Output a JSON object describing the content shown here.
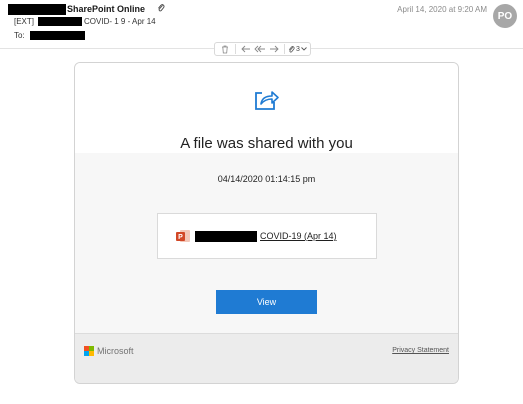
{
  "header": {
    "sender_name": "SharePoint Online",
    "subject_prefix": "[EXT]",
    "subject_suffix": "COVID- 1 9 - Apr 14",
    "to_label": "To:",
    "date": "April 14, 2020 at 9:20 AM",
    "avatar_initials": "PO"
  },
  "toolbar": {
    "attachment_count": "3"
  },
  "card": {
    "title": "A file was shared with you",
    "shared_date": "04/14/2020 01:14:15 pm",
    "file_name": "COVID-19 (Apr 14)",
    "view_label": "View",
    "brand": "Microsoft",
    "privacy_label": "Privacy Statement"
  },
  "colors": {
    "accent": "#1f7bd3",
    "powerpoint": "#d24726",
    "avatar": "#a7a7a7"
  }
}
